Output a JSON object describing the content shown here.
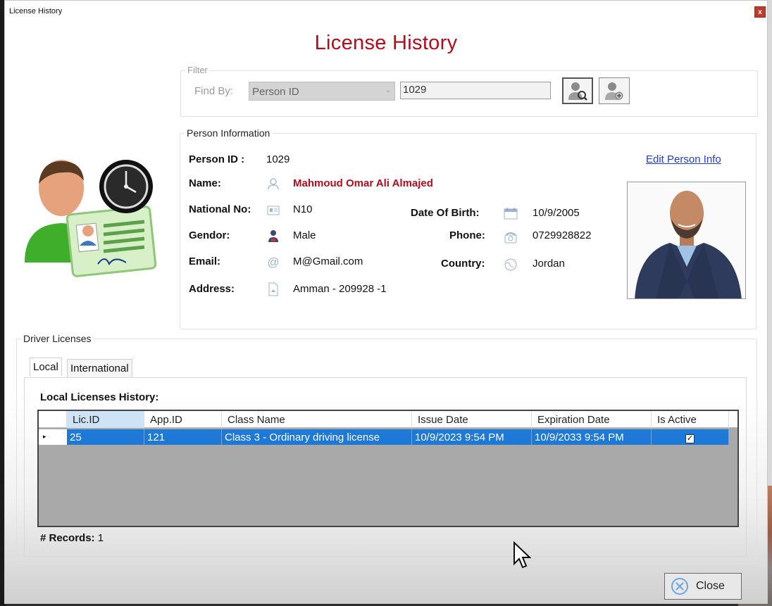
{
  "window": {
    "title": "License History",
    "close_glyph": "x"
  },
  "header": {
    "title": "License History"
  },
  "filter": {
    "legend": "Filter",
    "find_by_label": "Find By:",
    "find_by_selected": "Person ID",
    "search_value": "1029",
    "find_icon": "find-person-icon",
    "add_icon": "add-person-icon"
  },
  "person": {
    "legend": "Person Information",
    "person_id_label": "Person ID :",
    "person_id": "1029",
    "edit_link": "Edit Person Info",
    "name_label": "Name:",
    "name": "Mahmoud Omar Ali Almajed",
    "national_no_label": "National No:",
    "national_no": "N10",
    "gender_label": "Gendor:",
    "gender": "Male",
    "email_label": "Email:",
    "email": "M@Gmail.com",
    "address_label": "Address:",
    "address": "Amman - 209928 -1",
    "dob_label": "Date Of Birth:",
    "dob": "10/9/2005",
    "phone_label": "Phone:",
    "phone": "0729928822",
    "country_label": "Country:",
    "country": "Jordan"
  },
  "licenses": {
    "legend": "Driver Licenses",
    "tabs": [
      "Local",
      "International"
    ],
    "grid_title": "Local Licenses History:",
    "columns": [
      "Lic.ID",
      "App.ID",
      "Class Name",
      "Issue Date",
      "Expiration Date",
      "Is Active"
    ],
    "rows": [
      {
        "lic_id": "25",
        "app_id": "121",
        "class_name": "Class 3 - Ordinary driving license",
        "issue_date": "10/9/2023 9:54 PM",
        "expiration_date": "10/9/2033 9:54 PM",
        "is_active": "✓"
      }
    ],
    "records_label": "# Records:",
    "records_count": "1"
  },
  "footer": {
    "close_label": "Close"
  },
  "colors": {
    "title": "#b10d1c",
    "selection": "#1e78d6",
    "link": "#1f3ccf"
  }
}
